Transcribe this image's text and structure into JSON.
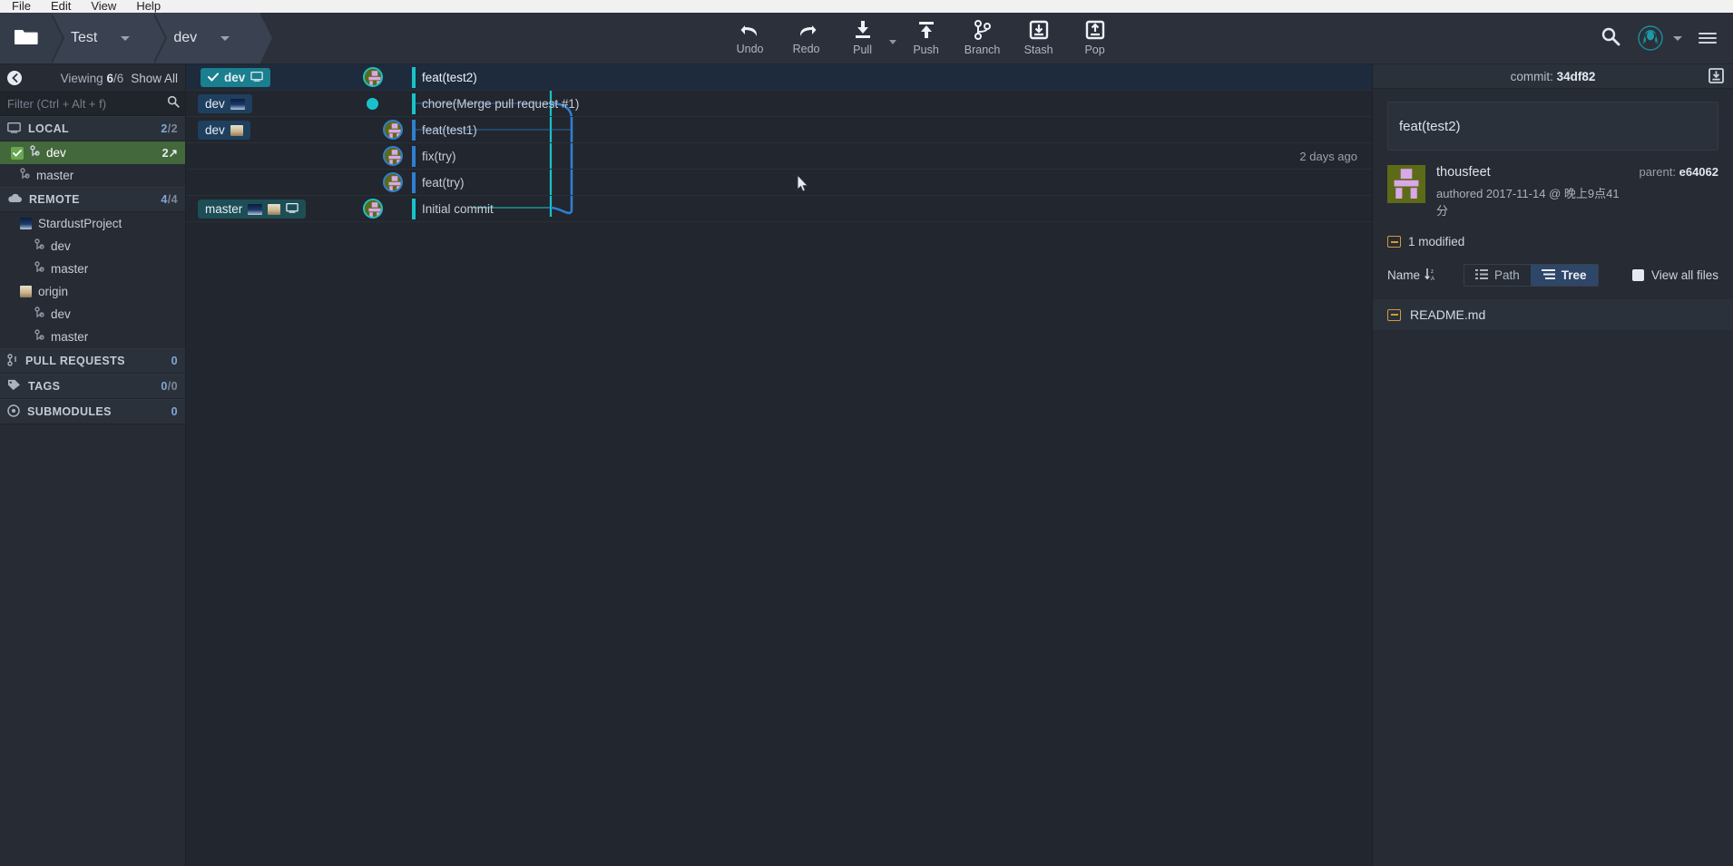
{
  "menubar": {
    "items": [
      "File",
      "Edit",
      "View",
      "Help"
    ]
  },
  "toolbar": {
    "folder_icon": "folder-icon",
    "repo_name": "Test",
    "branch_name": "dev",
    "actions": [
      {
        "label": "Undo",
        "icon": "undo-icon"
      },
      {
        "label": "Redo",
        "icon": "redo-icon"
      },
      {
        "label": "Pull",
        "icon": "pull-icon"
      },
      {
        "label": "Push",
        "icon": "push-icon"
      },
      {
        "label": "Branch",
        "icon": "branch-icon"
      },
      {
        "label": "Stash",
        "icon": "stash-icon"
      },
      {
        "label": "Pop",
        "icon": "pop-icon"
      }
    ],
    "search_icon": "search-icon",
    "avatar_icon": "kraken-avatar-icon",
    "menu_icon": "hamburger-menu-icon"
  },
  "sidebar": {
    "collapse_icon": "chevron-left-icon",
    "viewing_label": "Viewing",
    "viewing_current": "6",
    "viewing_total": "/6",
    "show_all": "Show All",
    "filter_placeholder": "Filter (Ctrl + Alt + f)",
    "filter_value": "",
    "sections": [
      {
        "title": "LOCAL",
        "icon": "monitor-icon",
        "count_a": "2",
        "count_b": "/2",
        "rows": [
          {
            "label": "dev",
            "icon": "branch-icon",
            "active": true,
            "badge": "2↗",
            "checked": true,
            "indent": 1
          },
          {
            "label": "master",
            "icon": "branch-icon",
            "active": false,
            "badge": "",
            "indent": 1
          }
        ]
      },
      {
        "title": "REMOTE",
        "icon": "cloud-icon",
        "count_a": "4",
        "count_b": "/4",
        "rows": [
          {
            "label": "StardustProject",
            "icon": "remote-avatar-stardust",
            "indent": 1
          },
          {
            "label": "dev",
            "icon": "branch-icon",
            "indent": 2
          },
          {
            "label": "master",
            "icon": "branch-icon",
            "indent": 2
          },
          {
            "label": "origin",
            "icon": "remote-avatar-origin",
            "indent": 1
          },
          {
            "label": "dev",
            "icon": "branch-icon",
            "indent": 2
          },
          {
            "label": "master",
            "icon": "branch-icon",
            "indent": 2
          }
        ]
      },
      {
        "title": "PULL REQUESTS",
        "icon": "pull-request-icon",
        "count_a": "0",
        "count_b": "",
        "rows": []
      },
      {
        "title": "TAGS",
        "icon": "tag-icon",
        "count_a": "0",
        "count_b": "/0",
        "rows": []
      },
      {
        "title": "SUBMODULES",
        "icon": "submodule-icon",
        "count_a": "0",
        "count_b": "",
        "rows": []
      }
    ]
  },
  "graph": {
    "rows": [
      {
        "message": "feat(test2)",
        "selected": true,
        "when": "",
        "refs": [
          {
            "text": "dev",
            "type": "current",
            "check": true,
            "icons": [
              "monitor-icon"
            ]
          }
        ]
      },
      {
        "message": "chore(Merge pull request #1)",
        "selected": false,
        "when": "",
        "refs": [
          {
            "text": "dev",
            "type": "local",
            "check": false,
            "icons": [
              "remote-avatar-stardust"
            ]
          }
        ]
      },
      {
        "message": "feat(test1)",
        "selected": false,
        "when": "",
        "refs": [
          {
            "text": "dev",
            "type": "local",
            "check": false,
            "icons": [
              "remote-avatar-origin"
            ]
          }
        ]
      },
      {
        "message": "fix(try)",
        "selected": false,
        "when": "2 days ago",
        "refs": []
      },
      {
        "message": "feat(try)",
        "selected": false,
        "when": "",
        "refs": []
      },
      {
        "message": "Initial commit",
        "selected": false,
        "when": "",
        "refs": [
          {
            "text": "master",
            "type": "master",
            "check": false,
            "icons": [
              "remote-avatar-stardust",
              "remote-avatar-origin",
              "monitor-icon"
            ]
          }
        ]
      }
    ]
  },
  "right_panel": {
    "commit_label": "commit:",
    "commit_hash": "34df82",
    "download_icon": "download-box-icon",
    "commit_message": "feat(test2)",
    "author": "thousfeet",
    "authored": "authored 2017-11-14 @ 晚上9点41分",
    "parent_label": "parent:",
    "parent_hash": "e64062",
    "modified_count": "1 modified",
    "name_sort_label": "Name",
    "sort_icon": "sort-az-icon",
    "path_label": "Path",
    "tree_label": "Tree",
    "active_view": "Tree",
    "view_all_files": "View all files",
    "files": [
      {
        "name": "README.md",
        "icon": "file-modified-icon"
      }
    ]
  },
  "colors": {
    "accent_teal": "#19c2c9",
    "branch_blue": "#2f7fd1",
    "active_green": "#3d6336",
    "selection_blue": "#1d2b3c"
  }
}
